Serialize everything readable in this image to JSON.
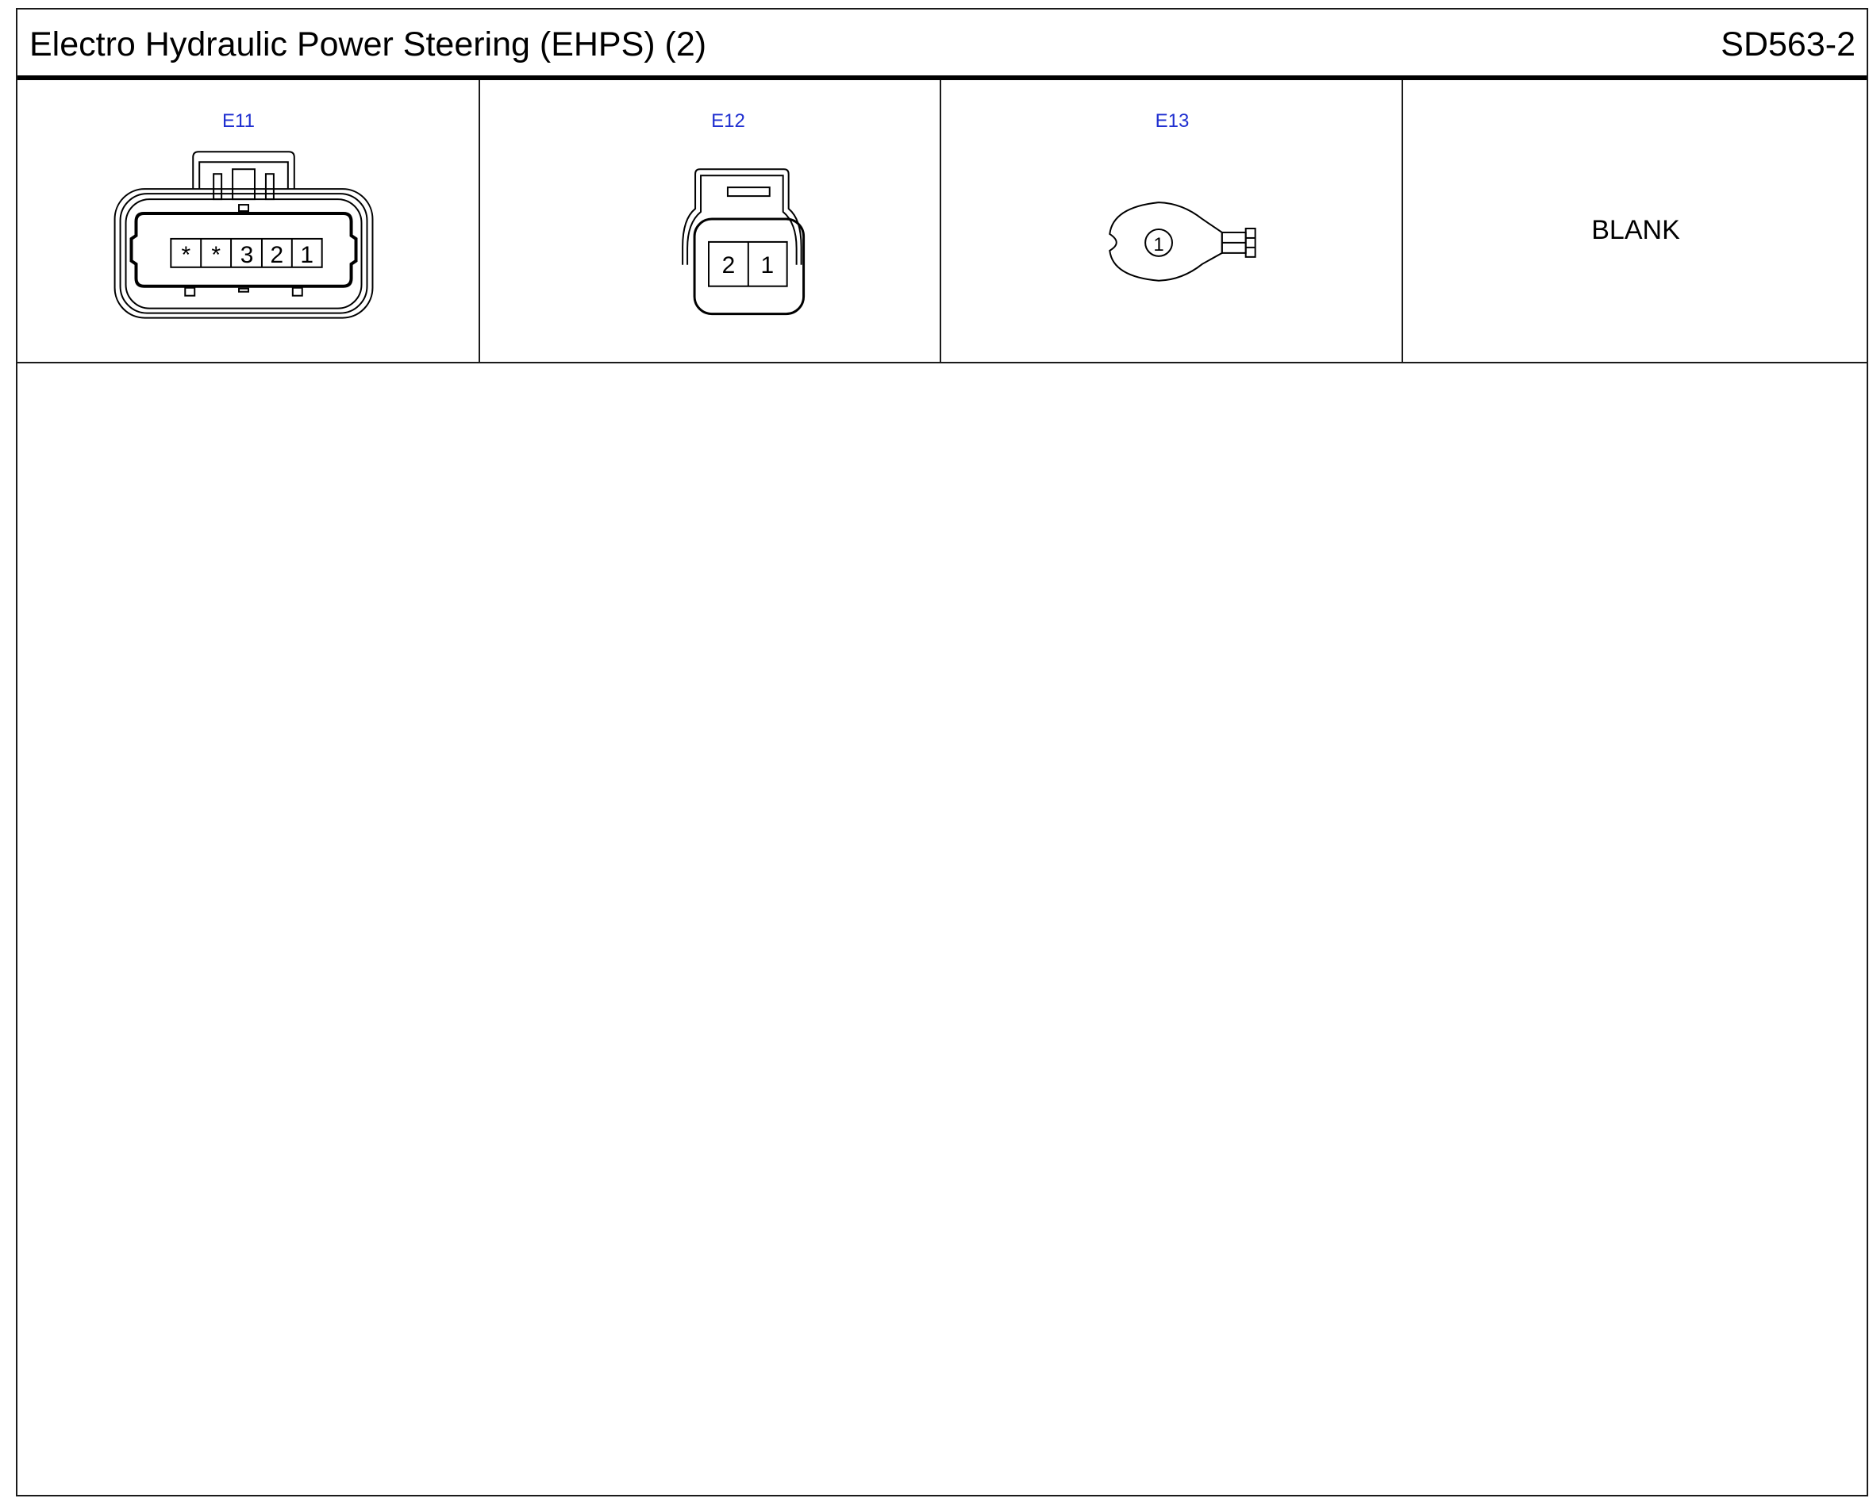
{
  "header": {
    "title": "Electro Hydraulic Power Steering (EHPS) (2)",
    "code": "SD563-2"
  },
  "connectors": [
    {
      "id": "E11",
      "pins": [
        "*",
        "*",
        "3",
        "2",
        "1"
      ]
    },
    {
      "id": "E12",
      "pins": [
        "2",
        "1"
      ]
    },
    {
      "id": "E13",
      "pins": [
        "1"
      ]
    }
  ],
  "blank_cell": {
    "label": "BLANK"
  },
  "colors": {
    "connector_label": "#1f2fd0",
    "line": "#000000"
  }
}
